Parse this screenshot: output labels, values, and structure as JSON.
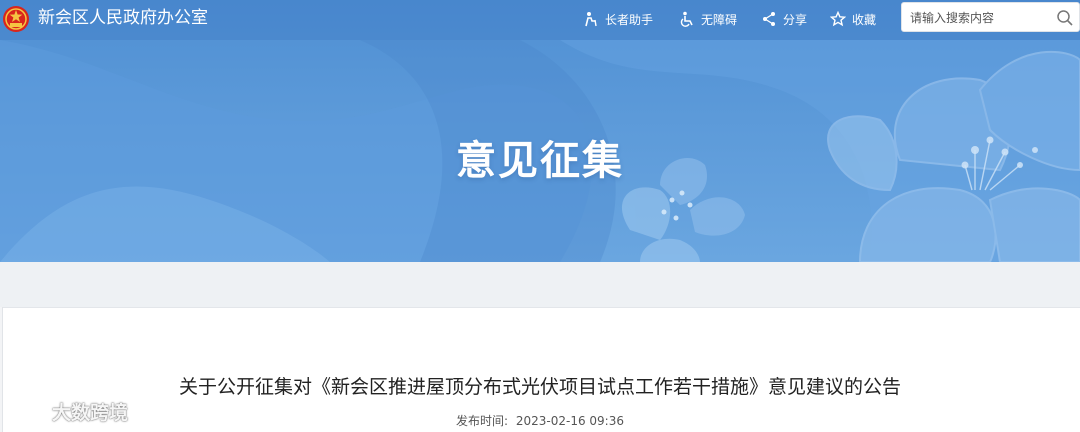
{
  "header": {
    "site_title": "新会区人民政府办公室",
    "tools": [
      {
        "label": "长者助手",
        "icon": "elder-helper-icon"
      },
      {
        "label": "无障碍",
        "icon": "accessibility-icon"
      },
      {
        "label": "分享",
        "icon": "share-icon"
      },
      {
        "label": "收藏",
        "icon": "star-icon"
      }
    ],
    "search_placeholder": "请输入搜索内容"
  },
  "banner": {
    "title": "意见征集"
  },
  "article": {
    "title": "关于公开征集对《新会区推进屋顶分布式光伏项目试点工作若干措施》意见建议的公告",
    "publish_label": "发布时间:",
    "publish_time": "2023-02-16 09:36"
  },
  "watermark": {
    "text": "大数跨境"
  },
  "colors": {
    "banner_blue": "#5c9ad9",
    "topbar": "#3c78c3",
    "text_dark": "#222222"
  }
}
